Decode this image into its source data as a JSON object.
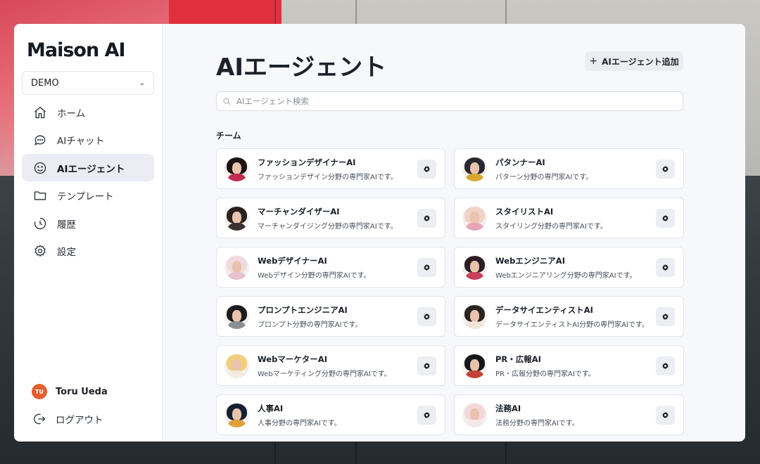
{
  "app": {
    "logo": "Maison AI",
    "org": "DEMO"
  },
  "sidebar": {
    "items": [
      {
        "label": "ホーム",
        "icon": "home-icon"
      },
      {
        "label": "AIチャット",
        "icon": "chat-icon"
      },
      {
        "label": "AIエージェント",
        "icon": "smile-icon",
        "active": true
      },
      {
        "label": "テンプレート",
        "icon": "folder-icon"
      },
      {
        "label": "履歴",
        "icon": "history-icon"
      },
      {
        "label": "設定",
        "icon": "gear-icon"
      }
    ],
    "user": {
      "initials": "TU",
      "name": "Toru Ueda"
    },
    "logout_label": "ログアウト"
  },
  "main": {
    "title": "AIエージェント",
    "add_button": "AIエージェント追加",
    "search_placeholder": "AIエージェント検索",
    "section": "チーム",
    "agents": [
      {
        "name": "ファッションデザイナーAI",
        "desc": "ファッションデザイン分野の専門家AIです。",
        "hair": "#1b1214",
        "body": "#c4294f"
      },
      {
        "name": "パタンナーAI",
        "desc": "パターン分野の専門家AIです。",
        "hair": "#2a2730",
        "body": "#d8a733"
      },
      {
        "name": "マーチャンダイザーAI",
        "desc": "マーチャンダイジング分野の専門家AIです。",
        "hair": "#2a2220",
        "body": "#3a3230"
      },
      {
        "name": "スタイリストAI",
        "desc": "スタイリング分野の専門家AIです。",
        "hair": "#f1d2c6",
        "body": "#e7a5b7"
      },
      {
        "name": "WebデザイナーAI",
        "desc": "Webデザイン分野の専門家AIです。",
        "hair": "#f0d9de",
        "body": "#e6c1cf"
      },
      {
        "name": "WebエンジニアAI",
        "desc": "Webエンジニアリング分野の専門家AIです。",
        "hair": "#2b1f22",
        "body": "#c93f5c"
      },
      {
        "name": "プロンプトエンジニアAI",
        "desc": "プロンプト分野の専門家AIです。",
        "hair": "#1b1c20",
        "body": "#8b8f95"
      },
      {
        "name": "データサイエンティストAI",
        "desc": "データサイエンティストAI分野の専門家AIです。",
        "hair": "#2a2420",
        "body": "#f0e4d6"
      },
      {
        "name": "WebマーケターAI",
        "desc": "Webマーケティング分野の専門家AIです。",
        "hair": "#f0cf7a",
        "body": "#f4ece0"
      },
      {
        "name": "PR・広報AI",
        "desc": "PR・広報分野の専門家AIです。",
        "hair": "#16161a",
        "body": "#c44235"
      },
      {
        "name": "人事AI",
        "desc": "人事分野の専門家AIです。",
        "hair": "#162034",
        "body": "#e1a13a"
      },
      {
        "name": "法務AI",
        "desc": "法務分野の専門家AIです。",
        "hair": "#f3d7db",
        "body": "#f4e8ea"
      }
    ]
  }
}
